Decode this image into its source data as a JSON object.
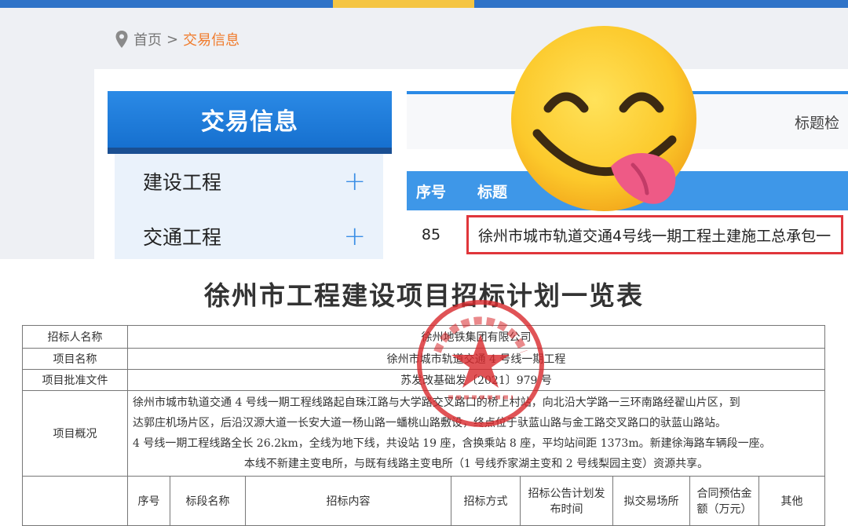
{
  "breadcrumb": {
    "home": "首页",
    "separator": ">",
    "current": "交易信息"
  },
  "sidebar": {
    "heading": "交易信息",
    "items": [
      {
        "label": "建设工程",
        "icon": "plus-icon"
      },
      {
        "label": "交通工程",
        "icon": "plus-icon"
      }
    ]
  },
  "search": {
    "label": "标题检"
  },
  "results_table": {
    "columns": [
      "序号",
      "标题"
    ],
    "rows": [
      {
        "no": "85",
        "title": "徐州市城市轨道交通4号线一期工程土建施工总承包一"
      }
    ]
  },
  "overlay": {
    "emoji": "face-savoring-food-emoji"
  },
  "document": {
    "title": "徐州市工程建设项目招标计划一览表",
    "rows": [
      {
        "label": "招标人名称",
        "value": "徐州地铁集团有限公司"
      },
      {
        "label": "项目名称",
        "value": "徐州市城市轨道交通 4 号线一期工程"
      },
      {
        "label": "项目批准文件",
        "value": "苏发改基础发〔2021〕979 号"
      }
    ],
    "overview_label": "项目概况",
    "overview_lines": [
      "徐州市城市轨道交通 4 号线一期工程线路起自珠江路与大学路交叉路口的桥上村站，向北沿大学路一三环南路经翟山片区，到",
      "达郭庄机场片区，后沿汉源大道一长安大道一杨山路一蟠桃山路敷设，终点位于驮蓝山路与金工路交叉路口的驮蓝山路站。",
      "4 号线一期工程线路全长 26.2km，全线为地下线，共设站 19 座，含换乘站 8 座，平均站间距 1373m。新建徐海路车辆段一座。",
      "本线不新建主变电所，与既有线路主变电所（1 号线乔家湖主变和 2 号线梨园主变）资源共享。"
    ],
    "plan_headers": [
      "序号",
      "标段名称",
      "招标内容",
      "招标方式",
      "招标公告计划发布时间",
      "拟交易场所",
      "合同预估金额（万元）",
      "其他"
    ],
    "stamp": {
      "color": "#d8282c",
      "name": "official-seal"
    }
  }
}
